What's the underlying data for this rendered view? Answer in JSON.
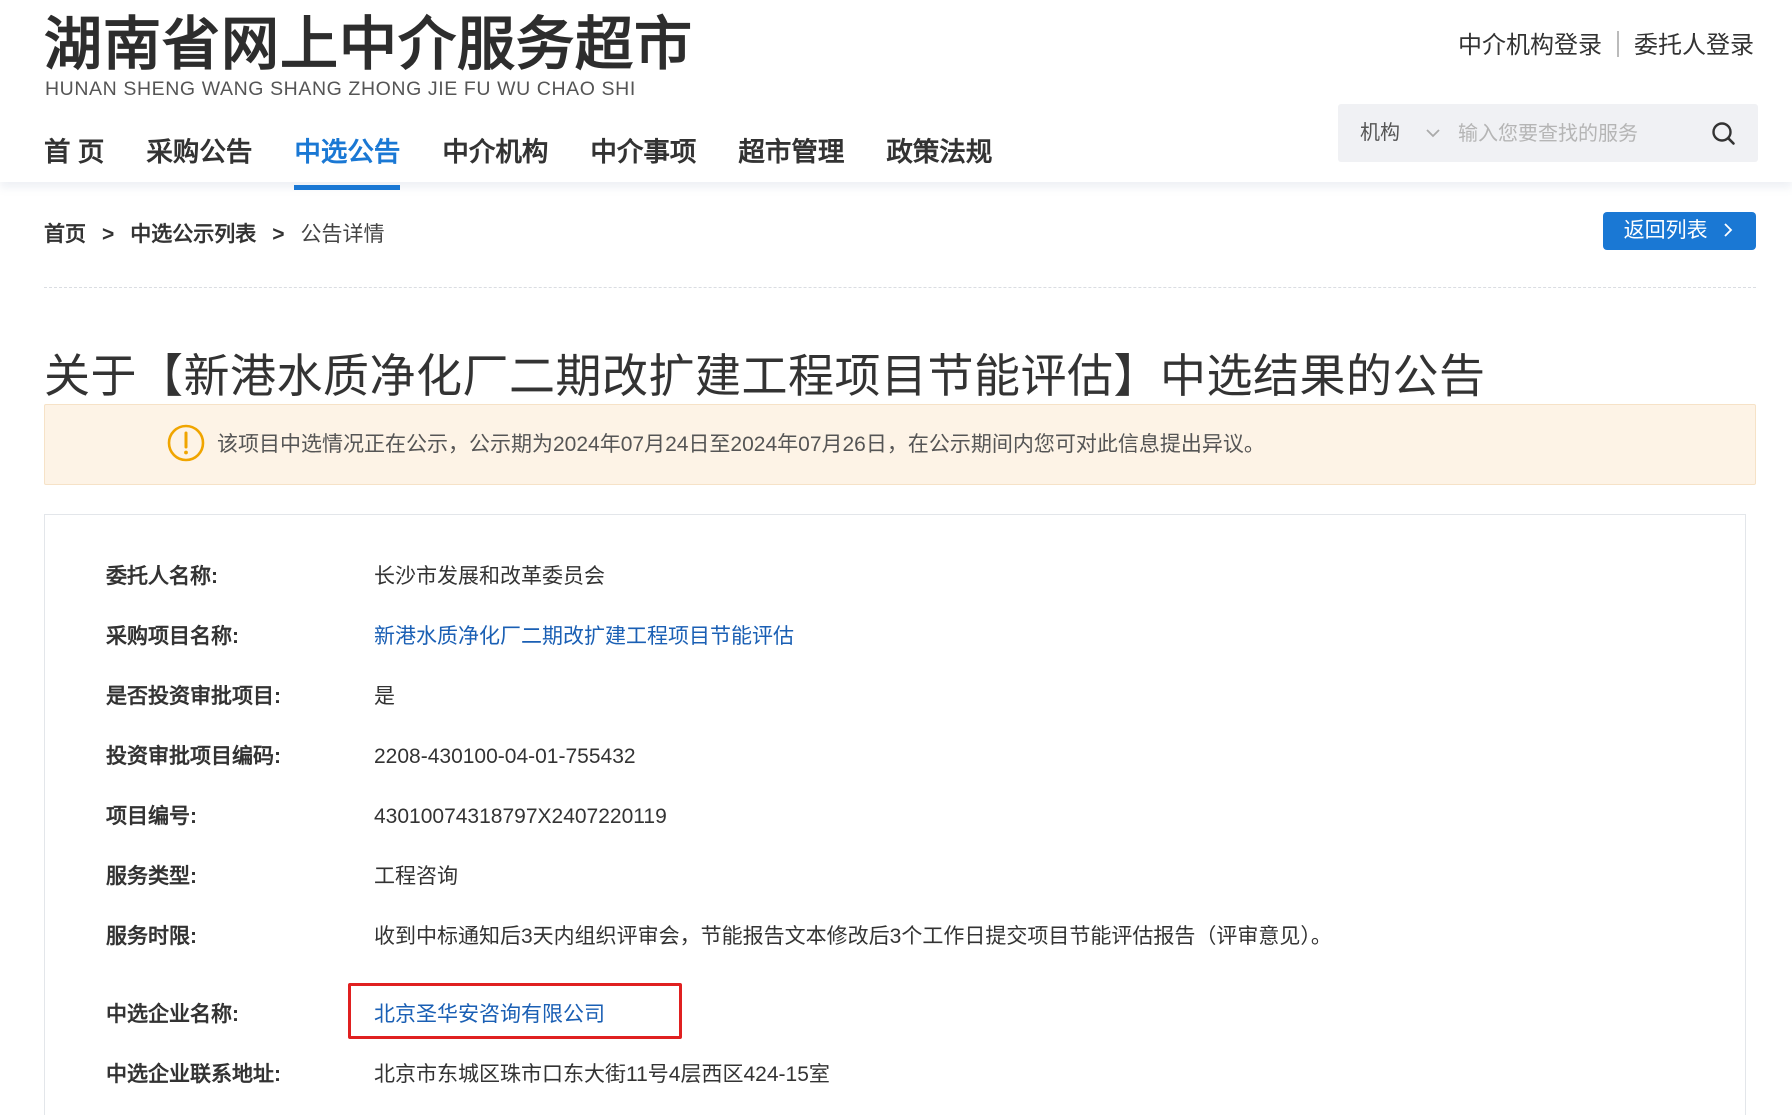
{
  "header": {
    "title": "湖南省网上中介服务超市",
    "subtitle": "HUNAN SHENG WANG SHANG ZHONG JIE FU WU CHAO SHI",
    "links": [
      "中介机构登录",
      "委托人登录"
    ]
  },
  "nav": {
    "items": [
      "首 页",
      "采购公告",
      "中选公告",
      "中介机构",
      "中介事项",
      "超市管理",
      "政策法规"
    ],
    "active": "中选公告"
  },
  "search": {
    "type": "机构",
    "placeholder": "输入您要查找的服务",
    "value": ""
  },
  "breadcrumb": {
    "items": [
      "首页",
      "中选公示列表",
      "公告详情"
    ],
    "separator": ">"
  },
  "back_button": "返回列表",
  "announcement": {
    "title": "关于【新港水质净化厂二期改扩建工程项目节能评估】中选结果的公告",
    "notice": "该项目中选情况正在公示，公示期为2024年07月24日至2024年07月26日，在公示期间内您可对此信息提出异议。"
  },
  "details": [
    {
      "label": "委托人名称:",
      "value": "长沙市发展和改革委员会"
    },
    {
      "label": "采购项目名称:",
      "value": "新港水质净化厂二期改扩建工程项目节能评估"
    },
    {
      "label": "是否投资审批项目:",
      "value": "是"
    },
    {
      "label": "投资审批项目编码:",
      "value": "2208-430100-04-01-755432"
    },
    {
      "label": "项目编号:",
      "value": "43010074318797X2407220119"
    },
    {
      "label": "服务类型:",
      "value": "工程咨询"
    },
    {
      "label": "服务时限:",
      "value": "收到中标通知后3天内组织评审会，节能报告文本修改后3个工作日提交项目节能评估报告（评审意见）。"
    },
    {
      "label": "中选企业名称:",
      "value": "北京圣华安咨询有限公司"
    },
    {
      "label": "中选企业联系地址:",
      "value": "北京市东城区珠市口东大街11号4层西区424-15室"
    }
  ],
  "colors": {
    "accent": "#1a78d4",
    "link": "#1a5fb4",
    "notice_bg": "#fdf3e6",
    "warning_icon": "#f0a500",
    "highlight_box": "#e02020"
  }
}
